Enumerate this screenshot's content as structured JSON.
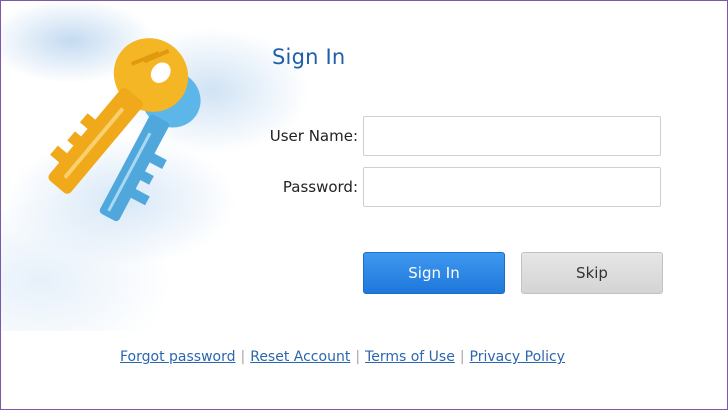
{
  "dialog": {
    "title": "Sign In"
  },
  "form": {
    "username_label": "User Name:",
    "username_value": "",
    "password_label": "Password:",
    "password_value": ""
  },
  "buttons": {
    "signin_label": "Sign In",
    "skip_label": "Skip"
  },
  "footer": {
    "links": [
      "Forgot password",
      "Reset Account",
      "Terms of Use",
      "Privacy Policy"
    ],
    "separator": "|"
  },
  "colors": {
    "accent": "#1f78db",
    "title": "#1f5fa8",
    "link": "#2b66b0",
    "frame_border": "#7a5aa6",
    "key_gold": "#f2b31f",
    "key_blue": "#58b3e6"
  },
  "icons": {
    "hero": "keys-icon"
  }
}
